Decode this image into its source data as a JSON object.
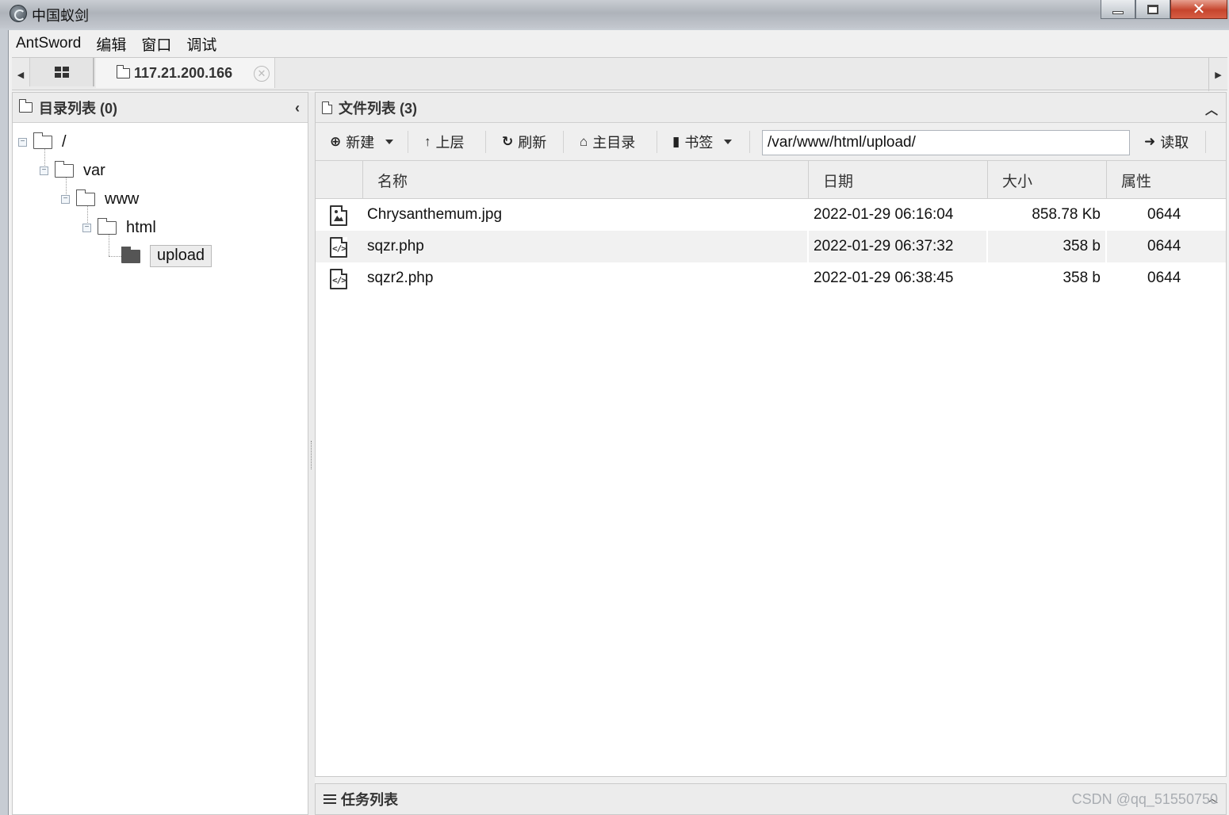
{
  "window": {
    "title": "中国蚁剑"
  },
  "menu": [
    "AntSword",
    "编辑",
    "窗口",
    "调试"
  ],
  "tabs": {
    "active_label": "117.21.200.166"
  },
  "dir_panel": {
    "title": "目录列表 (0)",
    "tree": [
      {
        "name": "/"
      },
      {
        "name": "var"
      },
      {
        "name": "www"
      },
      {
        "name": "html"
      },
      {
        "name": "upload"
      }
    ]
  },
  "file_panel": {
    "title": "文件列表 (3)",
    "toolbar": {
      "new": "新建",
      "up": "上层",
      "refresh": "刷新",
      "home": "主目录",
      "bookmark": "书签",
      "read": "读取"
    },
    "path": "/var/www/html/upload/",
    "columns": [
      "名称",
      "日期",
      "大小",
      "属性"
    ],
    "files": [
      {
        "name": "Chrysanthemum.jpg",
        "date": "2022-01-29 06:16:04",
        "size": "858.78 Kb",
        "perm": "0644",
        "type": "image"
      },
      {
        "name": "sqzr.php",
        "date": "2022-01-29 06:37:32",
        "size": "358 b",
        "perm": "0644",
        "type": "code"
      },
      {
        "name": "sqzr2.php",
        "date": "2022-01-29 06:38:45",
        "size": "358 b",
        "perm": "0644",
        "type": "code"
      }
    ]
  },
  "task_panel": {
    "title": "任务列表"
  },
  "watermark": "CSDN @qq_51550750"
}
